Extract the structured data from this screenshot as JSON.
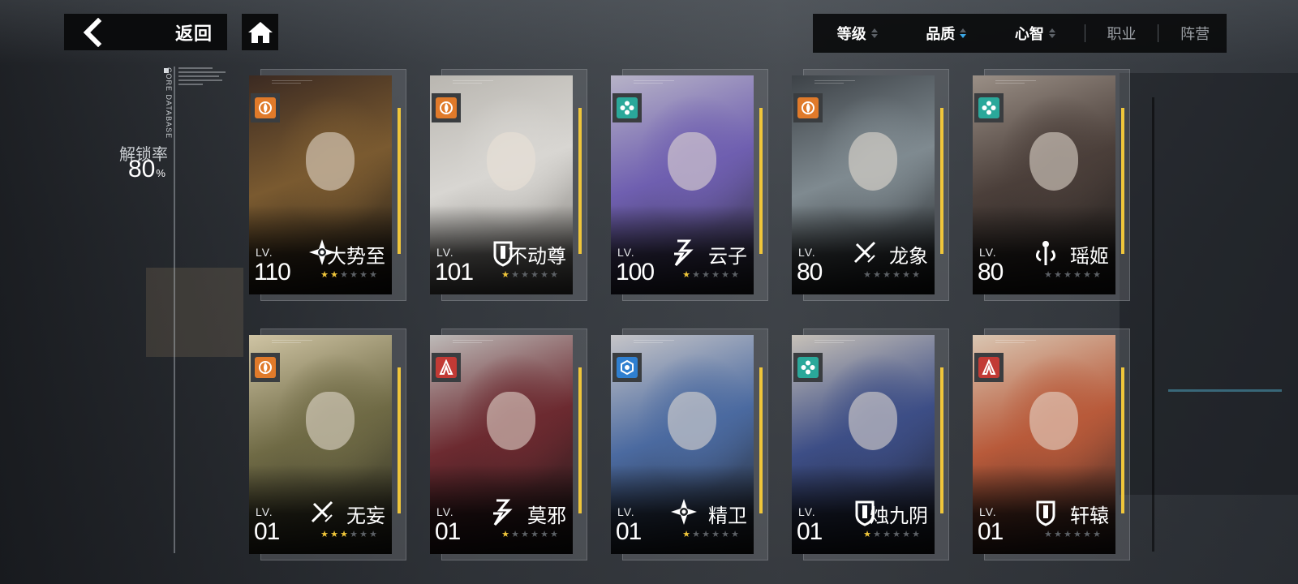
{
  "nav": {
    "back_label": "返回",
    "back_icon": "chevron-left-icon",
    "home_icon": "home-icon"
  },
  "sort": {
    "items": [
      {
        "label": "等级",
        "arrows": true,
        "active": false
      },
      {
        "label": "品质",
        "arrows": true,
        "active": true
      },
      {
        "label": "心智",
        "arrows": true,
        "active": false
      },
      {
        "label": "职业",
        "arrows": false,
        "active": false
      },
      {
        "label": "阵营",
        "arrows": false,
        "active": false
      }
    ],
    "active_color": "#3aa7e6"
  },
  "sidebar": {
    "database_text": "CORE DATABASE",
    "unlock_label": "解锁率",
    "unlock_value": "80",
    "unlock_unit": "%"
  },
  "theme": {
    "accent_yellow": "#f0c63a",
    "class_orange": "#e07a2a",
    "class_teal": "#2aa89a",
    "class_red": "#c23a35",
    "class_blue": "#2f7fd0"
  },
  "cards": [
    {
      "name": "大势至",
      "lv_label": "LV.",
      "level": "110",
      "stars": 2,
      "class_icon": "orange-spiral-icon",
      "class_color": "#e07a2a",
      "job_icon": "gear-sun-icon"
    },
    {
      "name": "不动尊",
      "lv_label": "LV.",
      "level": "101",
      "stars": 1,
      "class_icon": "orange-spiral-icon",
      "class_color": "#e07a2a",
      "job_icon": "shield-icon"
    },
    {
      "name": "云子",
      "lv_label": "LV.",
      "level": "100",
      "stars": 1,
      "class_icon": "teal-cross-icon",
      "class_color": "#2aa89a",
      "job_icon": "lightning-icon"
    },
    {
      "name": "龙象",
      "lv_label": "LV.",
      "level": "80",
      "stars": 0,
      "class_icon": "orange-spiral-icon",
      "class_color": "#e07a2a",
      "job_icon": "crossed-blades-icon"
    },
    {
      "name": "瑶姬",
      "lv_label": "LV.",
      "level": "80",
      "stars": 0,
      "class_icon": "teal-cross-icon",
      "class_color": "#2aa89a",
      "job_icon": "healer-icon"
    },
    {
      "name": "无妄",
      "lv_label": "LV.",
      "level": "01",
      "stars": 3,
      "class_icon": "orange-spiral-icon",
      "class_color": "#e07a2a",
      "job_icon": "crossed-blades-icon"
    },
    {
      "name": "莫邪",
      "lv_label": "LV.",
      "level": "01",
      "stars": 1,
      "class_icon": "red-tower-icon",
      "class_color": "#c23a35",
      "job_icon": "lightning-icon"
    },
    {
      "name": "精卫",
      "lv_label": "LV.",
      "level": "01",
      "stars": 1,
      "class_icon": "blue-hex-icon",
      "class_color": "#2f7fd0",
      "job_icon": "gear-sun-icon"
    },
    {
      "name": "烛九阴",
      "lv_label": "LV.",
      "level": "01",
      "stars": 1,
      "class_icon": "teal-cross-icon",
      "class_color": "#2aa89a",
      "job_icon": "shield-icon"
    },
    {
      "name": "轩辕",
      "lv_label": "LV.",
      "level": "01",
      "stars": 0,
      "class_icon": "red-tower-icon",
      "class_color": "#c23a35",
      "job_icon": "shield-icon"
    }
  ]
}
